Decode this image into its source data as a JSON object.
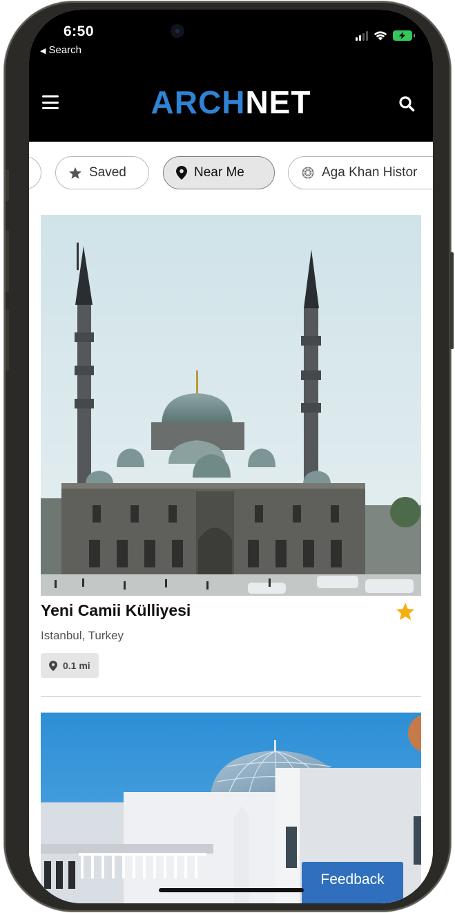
{
  "status_bar": {
    "time": "6:50",
    "back_label": "Search",
    "battery_color": "#35c759"
  },
  "header": {
    "logo_part1": "ARCH",
    "logo_part2": "NET",
    "logo_part1_color": "#2f83d4",
    "menu_icon": "hamburger-menu-icon",
    "search_icon": "search-icon"
  },
  "filters": {
    "chips": [
      {
        "label": "Saved",
        "icon": "star-icon",
        "active": false
      },
      {
        "label": "Near Me",
        "icon": "map-pin-icon",
        "active": true
      },
      {
        "label": "Aga Khan Histor",
        "icon": "aga-khan-emblem-icon",
        "active": false
      }
    ]
  },
  "results": [
    {
      "title": "Yeni Camii Külliyesi",
      "location": "Istanbul, Turkey",
      "distance": "0.1 mi",
      "saved": true,
      "star_color": "#f6ae11"
    }
  ],
  "feedback": {
    "label": "Feedback",
    "color": "#2f6fbe"
  }
}
